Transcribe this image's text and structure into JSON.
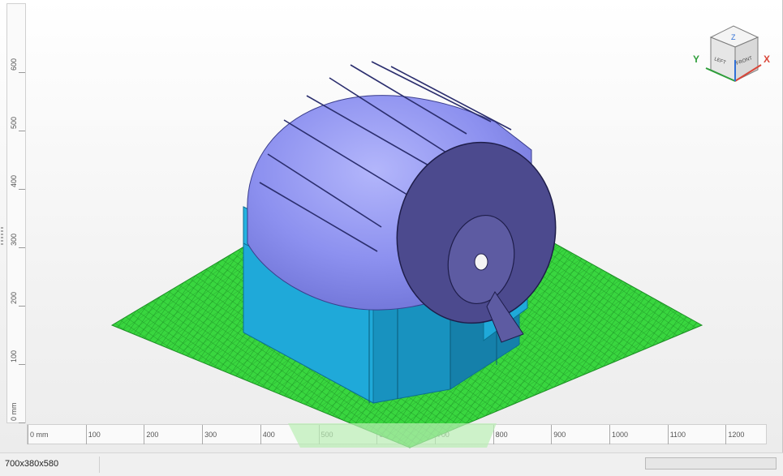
{
  "viewport": {
    "vertical_ruler": {
      "labels": [
        "0 mm",
        "100",
        "200",
        "300",
        "400",
        "500",
        "600"
      ]
    },
    "horizontal_ruler": {
      "labels": [
        "0 mm",
        "100",
        "200",
        "300",
        "400",
        "500",
        "600",
        "700",
        "800",
        "900",
        "1000",
        "1100",
        "1200"
      ]
    },
    "viewcube": {
      "faces": {
        "top": "Z",
        "left": "LEFT",
        "front": "FRONT"
      },
      "axis_y": "Y",
      "axis_x": "X"
    },
    "colors": {
      "build_plate": "#2fc635",
      "model_body": "#9a9ef4",
      "supports": "#1aa6d4",
      "axis_x": "#d9473a",
      "axis_y": "#2e9e3a",
      "axis_z": "#2f6fd6"
    }
  },
  "statusbar": {
    "dimensions": "700x380x580",
    "progress": 0
  }
}
